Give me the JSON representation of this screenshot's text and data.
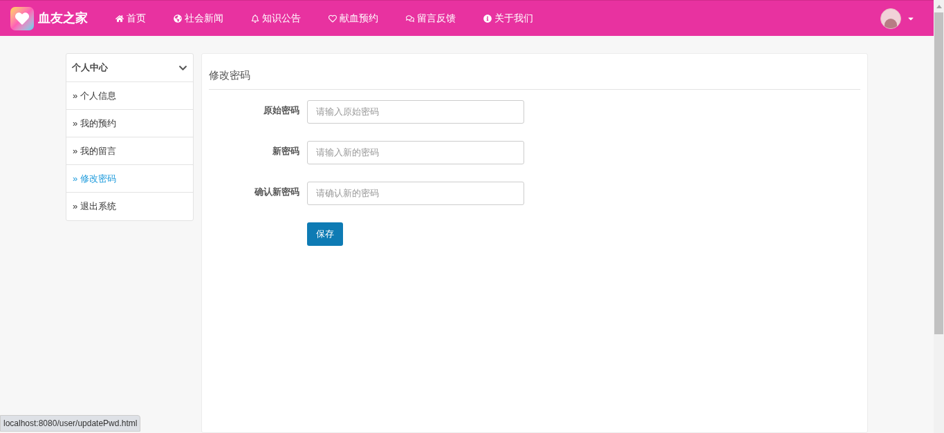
{
  "navbar": {
    "brand": "血友之家",
    "items": [
      {
        "label": "首页"
      },
      {
        "label": "社会新闻"
      },
      {
        "label": "知识公告"
      },
      {
        "label": "献血预约"
      },
      {
        "label": "留言反馈"
      },
      {
        "label": "关于我们"
      }
    ]
  },
  "sidebar": {
    "title": "个人中心",
    "expanded": true,
    "items": [
      {
        "label": "» 个人信息",
        "selected": false
      },
      {
        "label": "» 我的预约",
        "selected": false
      },
      {
        "label": "» 我的留言",
        "selected": false
      },
      {
        "label": "» 修改密码",
        "selected": true
      },
      {
        "label": "» 退出系统",
        "selected": false
      }
    ]
  },
  "panel": {
    "title": "修改密码",
    "fields": [
      {
        "label": "原始密码",
        "placeholder": "请输入原始密码"
      },
      {
        "label": "新密码",
        "placeholder": "请输入新的密码"
      },
      {
        "label": "确认新密码",
        "placeholder": "请确认新的密码"
      }
    ],
    "button": "保存"
  },
  "status_bar": {
    "url": "localhost:8080/user/updatePwd.html"
  }
}
